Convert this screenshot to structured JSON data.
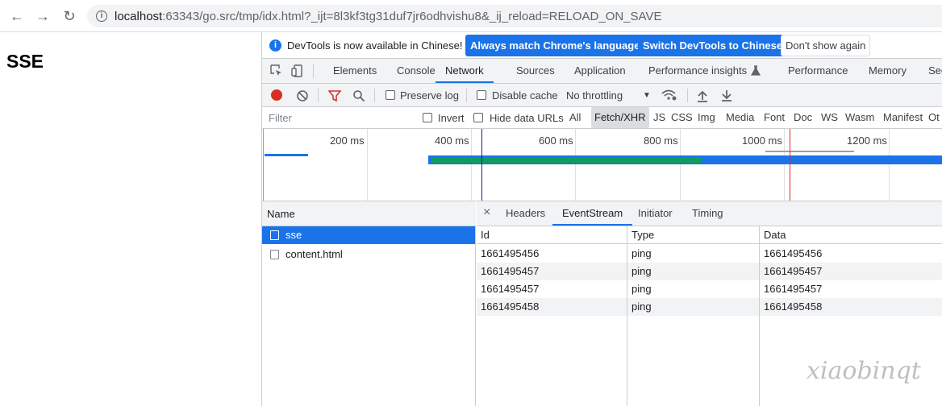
{
  "browser": {
    "back_icon": "arrow-left-icon",
    "forward_icon": "arrow-right-icon",
    "reload_icon": "reload-icon",
    "url_host": "localhost",
    "url_rest": ":63343/go.src/tmp/idx.html?_ijt=8l3kf3tg31duf7jr6odhvishu8&_ij_reload=RELOAD_ON_SAVE"
  },
  "page": {
    "heading": "SSE"
  },
  "devtools": {
    "infobar": {
      "message": "DevTools is now available in Chinese!",
      "btn_match": "Always match Chrome's language",
      "btn_switch": "Switch DevTools to Chinese",
      "btn_dismiss": "Don't show again"
    },
    "tabs": [
      "Elements",
      "Console",
      "Network",
      "Sources",
      "Application",
      "Performance insights",
      "Performance",
      "Memory",
      "Sec"
    ],
    "active_tab": "Network",
    "toolbar": {
      "preserve_log": "Preserve log",
      "disable_cache": "Disable cache",
      "throttling": "No throttling"
    },
    "filter": {
      "placeholder": "Filter",
      "invert": "Invert",
      "hide_data_urls": "Hide data URLs",
      "types": [
        "All",
        "Fetch/XHR",
        "JS",
        "CSS",
        "Img",
        "Media",
        "Font",
        "Doc",
        "WS",
        "Wasm",
        "Manifest",
        "Ot"
      ],
      "active_type": "Fetch/XHR"
    },
    "overview": {
      "ticks": [
        "200 ms",
        "400 ms",
        "600 ms",
        "800 ms",
        "1000 ms",
        "1200 ms"
      ]
    },
    "requests": {
      "header": "Name",
      "items": [
        {
          "name": "sse",
          "selected": true
        },
        {
          "name": "content.html",
          "selected": false
        }
      ]
    },
    "detail": {
      "tabs": [
        "Headers",
        "EventStream",
        "Initiator",
        "Timing"
      ],
      "active_tab": "EventStream",
      "columns": [
        "Id",
        "Type",
        "Data"
      ],
      "rows": [
        [
          "1661495456",
          "ping",
          "1661495456"
        ],
        [
          "1661495457",
          "ping",
          "1661495457"
        ],
        [
          "1661495457",
          "ping",
          "1661495457"
        ],
        [
          "1661495458",
          "ping",
          "1661495458"
        ]
      ]
    }
  },
  "watermark": "xiaobinqt",
  "colors": {
    "accent": "#1a73e8",
    "record": "#d93025",
    "timeline_green": "#0f9d58",
    "timeline_blue": "#1a73e8"
  }
}
